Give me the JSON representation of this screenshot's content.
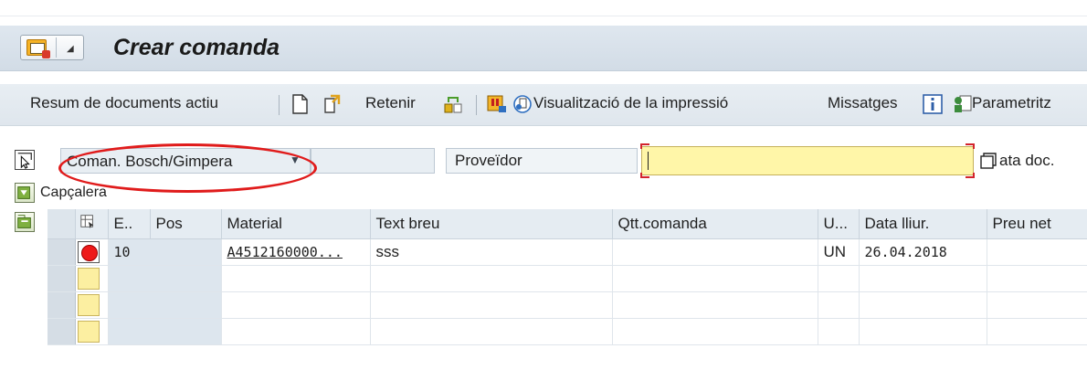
{
  "header": {
    "title": "Crear comanda"
  },
  "toolbar": {
    "doc_overview": "Resum de documents actiu",
    "hold": "Retenir",
    "print_preview": "Visualització de la impressió",
    "messages": "Missatges",
    "settings": "Parametritz"
  },
  "form": {
    "order_type": "Coman. Bosch/Gimpera",
    "order_type_extra": "",
    "vendor_label": "Proveïdor",
    "vendor_value": "",
    "doc_date_label": "ata doc.",
    "header_label": "Capçalera"
  },
  "grid": {
    "columns": [
      "E..",
      "Pos",
      "Material",
      "Text breu",
      "Qtt.comanda",
      "U...",
      "Data lliur.",
      "Preu net"
    ],
    "rows": [
      {
        "pos": "10",
        "material": "A4512160000...",
        "text": "sss",
        "qty": "",
        "unit": "UN",
        "date": "26.04.2018",
        "price": ""
      }
    ]
  },
  "colors": {
    "highlight_ellipse": "#e01b1b",
    "required_field": "#fff6a8"
  }
}
